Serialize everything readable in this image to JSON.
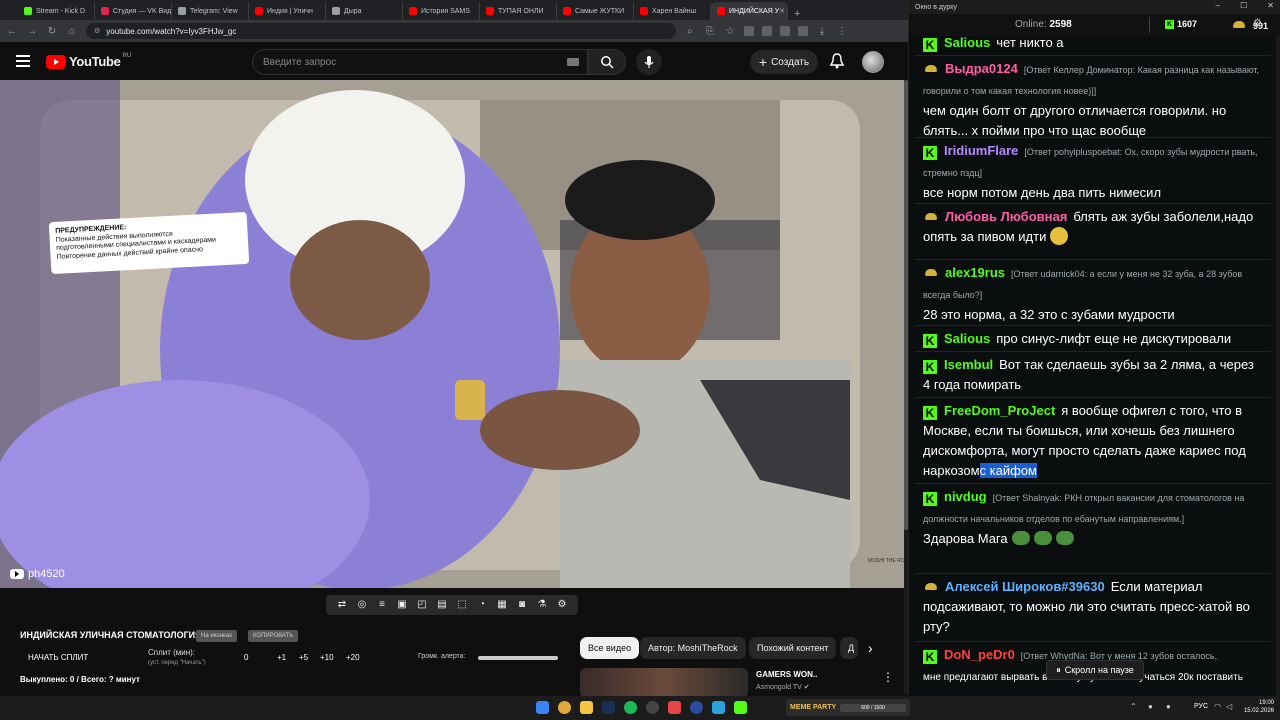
{
  "browser": {
    "tabs": [
      {
        "label": "Stream - Kick D",
        "color": "#53fc18"
      },
      {
        "label": "Студия — VK Вид",
        "color": "#e0234e"
      },
      {
        "label": "Telegram: View",
        "color": "#9aa0a6"
      },
      {
        "label": "Индия | Уличн",
        "color": "#ff0000"
      },
      {
        "label": "Дыра",
        "color": "#9aa0a6"
      },
      {
        "label": "История SAMS",
        "color": "#ff0000"
      },
      {
        "label": "ТУПАЯ ОНЛИ",
        "color": "#ff0000"
      },
      {
        "label": "Самые ЖУТКИ",
        "color": "#ff0000"
      },
      {
        "label": "Харен Вайнш",
        "color": "#ff0000"
      },
      {
        "label": "ИНДИЙСКАЯ У",
        "color": "#ff0000"
      }
    ],
    "new_tab": "+",
    "url": "youtube.com/watch?v=Iyv3FHJw_gc"
  },
  "youtube": {
    "logo_text": "YouTube",
    "country": "RU",
    "search_placeholder": "Введите запрос",
    "create_label": "Создать",
    "video": {
      "warning_title": "ПРЕДУПРЕЖДЕНИЕ:",
      "warning_lines": [
        "Показанные действия выполняются",
        "подготовленными специалистами и каскадерами",
        "Повторение данных действий крайне опасно"
      ],
      "channel_watermark": "ph4520",
      "corner_logo": "MOSHI THE ROCK"
    },
    "info": {
      "title": "ИНДИЙСКАЯ УЛИЧНАЯ СТОМАТОЛОГИЯ",
      "pill1": "На иконках",
      "pill2": "КОПИРОВАТЬ",
      "start_split": "НАЧАТЬ СПЛИТ",
      "split_min": "Сплит (мин):",
      "split_hint": "(уст. перед \"Начать\")",
      "split_values": [
        "0",
        "+1",
        "+5",
        "+10",
        "+20"
      ],
      "alert_label": "Громк. алерта:",
      "paid": "Выкуплено: 0 / Всего: ? минут"
    },
    "chips": [
      "Все видео",
      "Автор: MoshiTheRock",
      "Похожий контент",
      "Д"
    ],
    "recommended": {
      "title": "GAMERS WON..",
      "channel": "Asmongold TV"
    }
  },
  "chat": {
    "window_title": "Окно в дурку",
    "online_label": "Online:",
    "online_count": "2598",
    "kick_count": "1607",
    "gold_count": "991",
    "pause_label": "Скролл на паузе",
    "messages": [
      {
        "badge": "k",
        "user": "Salious",
        "color": "#53fc18",
        "reply": "",
        "text": "чет никто а"
      },
      {
        "badge": "gold",
        "user": "Выдра0124",
        "color": "#ff5fa2",
        "reply": "[Ответ Келлер Доминатор: Какая разница как называют, говорили о том какая технология новее)]]",
        "text": "чем один болт от другого отличается говорили. но блять... х пойми про что щас вообще"
      },
      {
        "badge": "k",
        "user": "IridiumFlare",
        "color": "#b388ff",
        "reply": "[Ответ pohyiplusроеbat: Ох, скоро зубы мудрости рвать, стремно пздц]",
        "text": "все норм потом день два пить нимесил"
      },
      {
        "badge": "gold",
        "user": "Любовь Любовная",
        "color": "#ff5fa2",
        "reply": "",
        "text": "блять аж зубы заболели,надо опять за пивом идти"
      },
      {
        "badge": "gold",
        "user": "alex19rus",
        "color": "#53fc18",
        "reply": "[Ответ udarnick04: а если у меня не 32 зуба, а 28 зубов всегда было?]",
        "text": "28 это норма, а 32 это с зубами мудрости"
      },
      {
        "badge": "k",
        "user": "Salious",
        "color": "#53fc18",
        "reply": "",
        "text": "про синус-лифт еще не дискутировали"
      },
      {
        "badge": "k",
        "user": "Isembul",
        "color": "#53fc18",
        "reply": "",
        "text": "Вот так сделаешь зубы за 2 ляма, а через 4 года помирать"
      },
      {
        "badge": "k",
        "user": "FreeDom_ProJect",
        "color": "#53fc18",
        "reply": "",
        "text": "я вообще офигел с того, что в Москве, если ты боишься, или хочешь без лишнего дискомфорта, могут просто сделать даже кариес под наркозом",
        "highlight": "с кайфом"
      },
      {
        "badge": "k",
        "user": "nivdug",
        "color": "#53fc18",
        "reply": "[Ответ Shalnyak: РКН открыл вакансии для стоматологов на должности начальников отделов по ебанутым направлениям.]",
        "text": "Здарова Мага"
      },
      {
        "badge": "gold",
        "user": "Алексей Широков#39630",
        "color": "#5fb0ff",
        "reply": "",
        "text": "Если материал подсаживают, то можно ли это считать пресс-хатой во рту?"
      },
      {
        "badge": "k",
        "user": "DoN_peDr0",
        "color": "#ff4040",
        "reply": "[Ответ WhydNa: Вот у меня 12 зубов осталось,",
        "text": "мне предлагают вырвать все нахуй уже и не мучаться 20к поставить"
      }
    ]
  },
  "taskbar": {
    "widget_brand": "MEME PARTY",
    "widget_progress": "600 / 1500",
    "lang": "РУС",
    "time": "19:00",
    "date": "15.02.2026"
  }
}
